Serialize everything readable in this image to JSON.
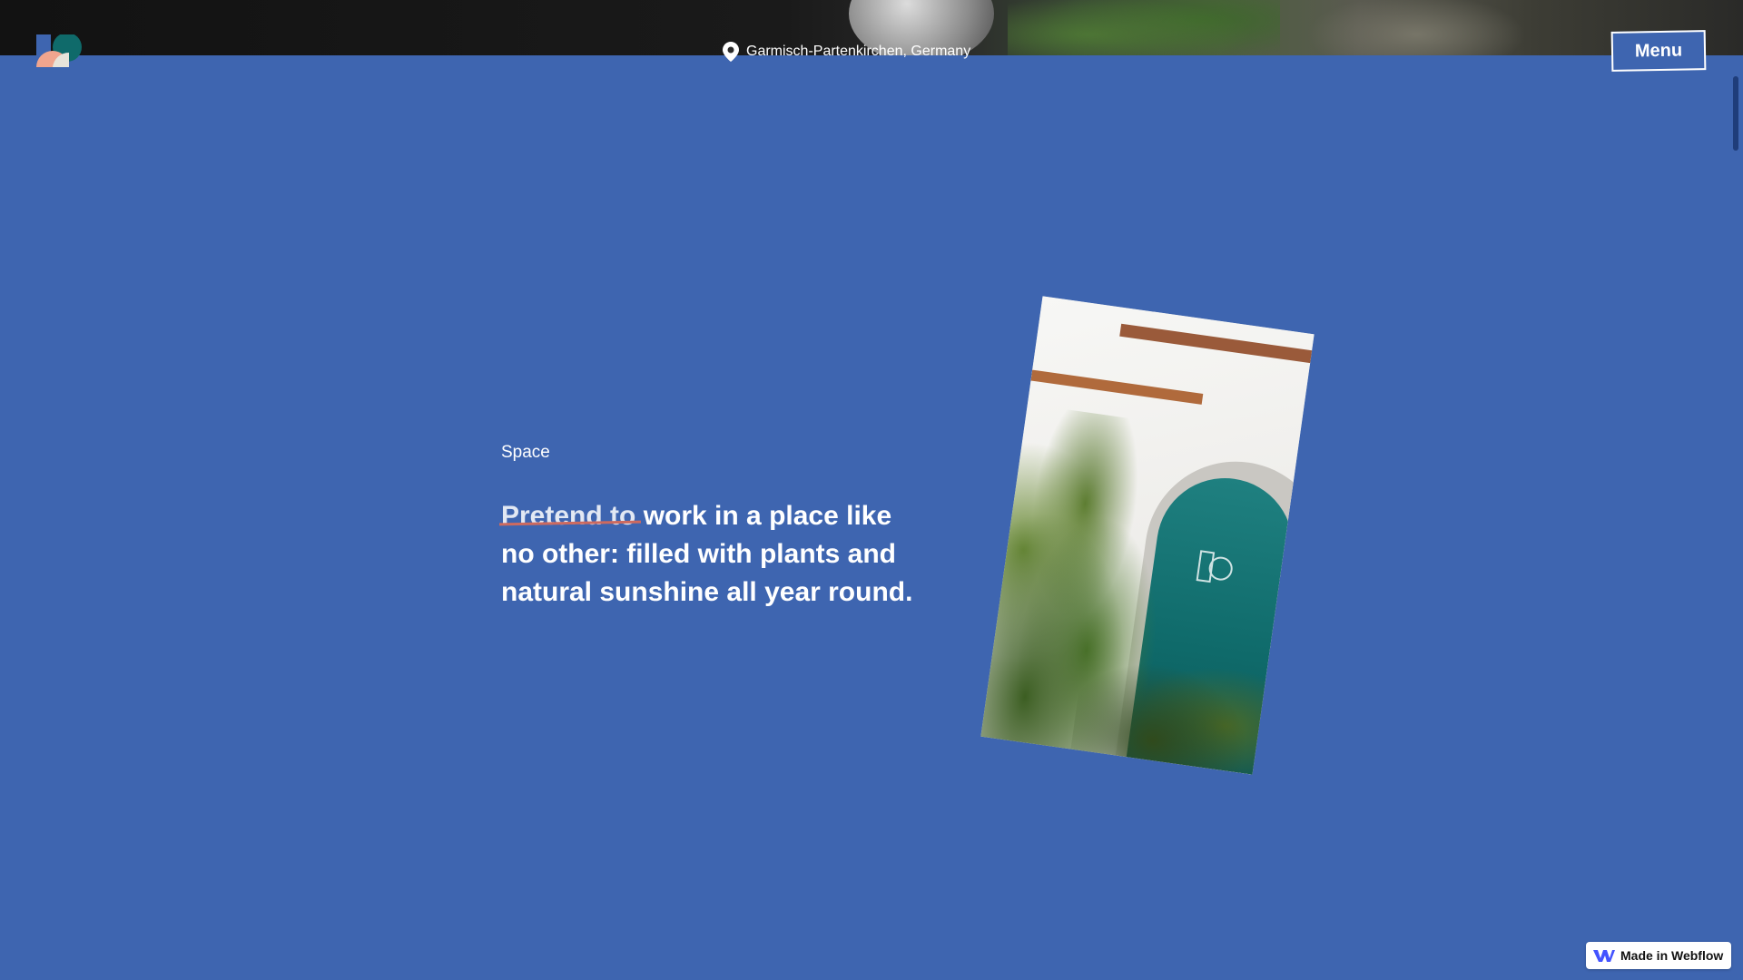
{
  "header": {
    "location": "Garmisch-Partenkirchen, Germany",
    "menu_label": "Menu"
  },
  "section": {
    "label": "Space",
    "headline_struck": "Pretend to",
    "headline_rest": " work in a place like no other: filled with plants and natural sunshine all year round."
  },
  "badge": {
    "label": "Made in Webflow"
  },
  "colors": {
    "background": "#3e65b0",
    "accent_strike": "#e66b52",
    "door": "#0f6a6a"
  },
  "icons": {
    "logo": "brand-logo-icon",
    "location": "map-pin-icon",
    "webflow": "webflow-icon"
  }
}
